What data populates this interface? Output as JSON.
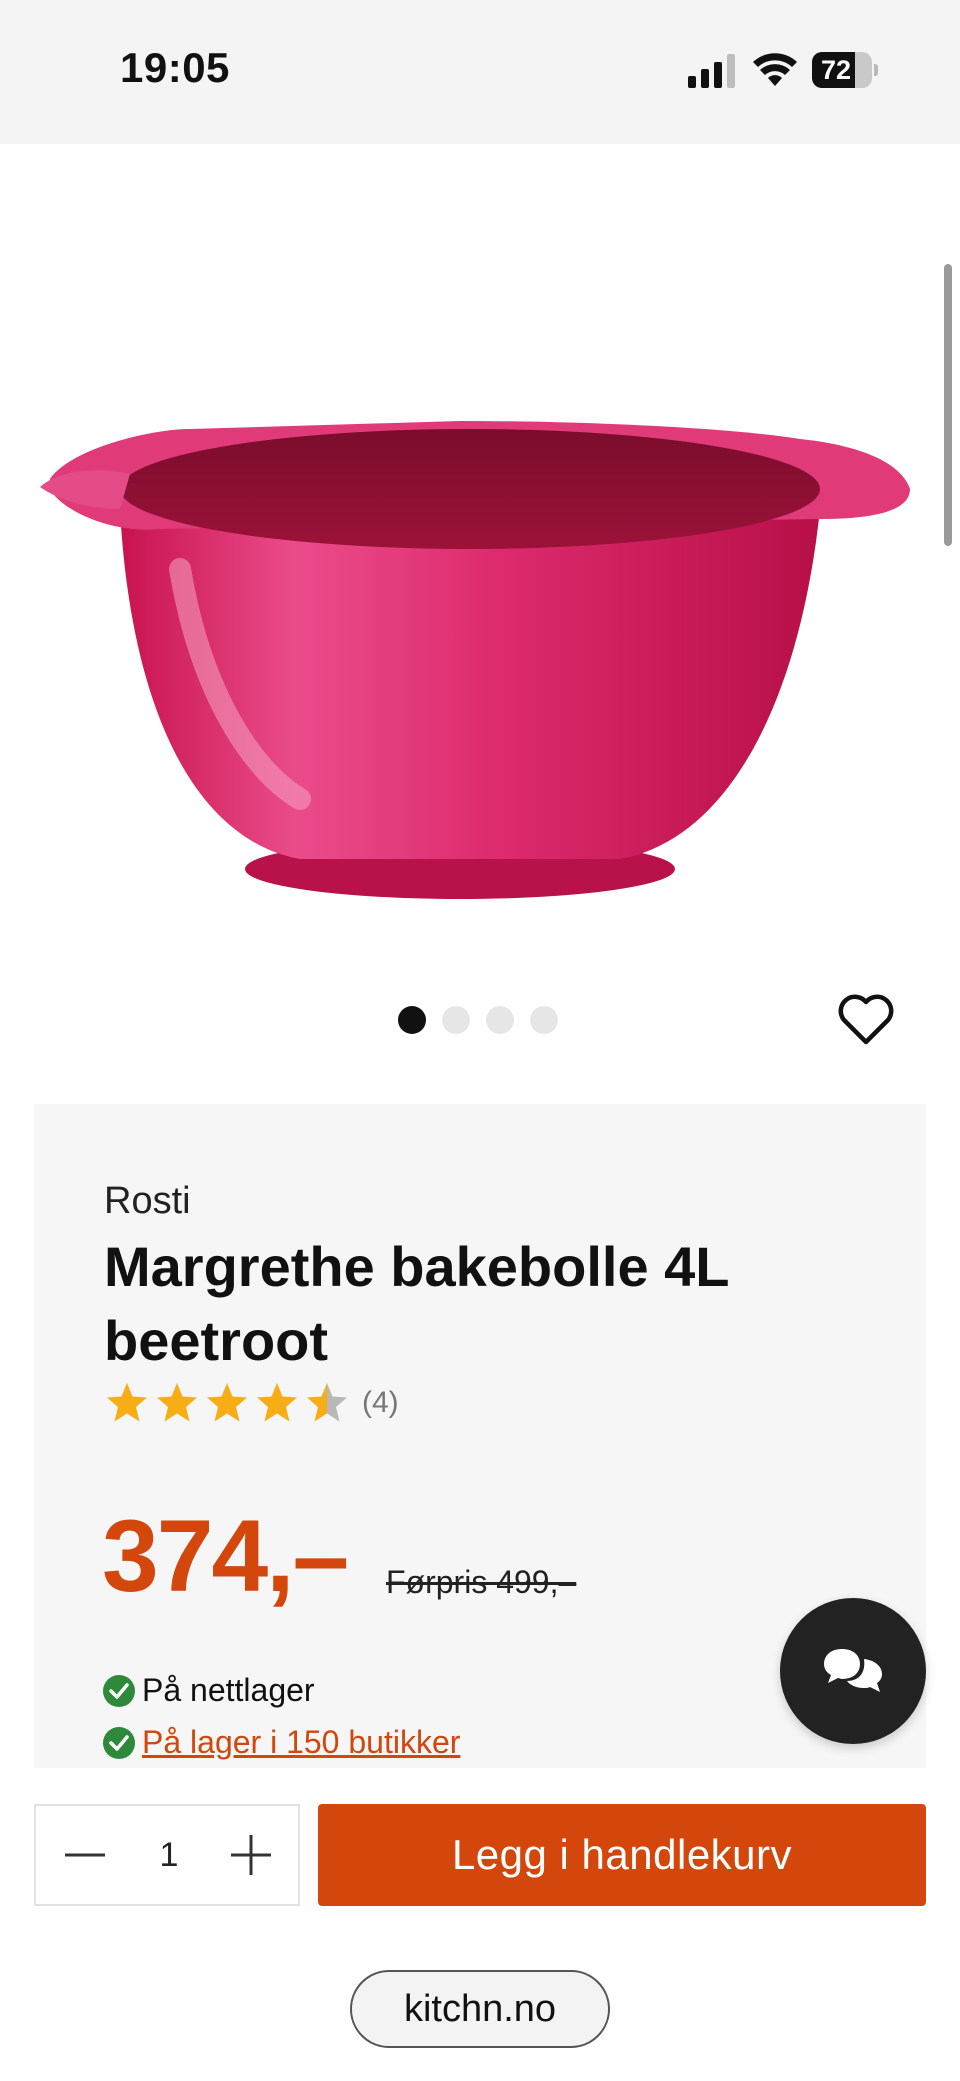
{
  "status_bar": {
    "time": "19:05",
    "battery_level": "72",
    "icons": [
      "cellular-signal-icon",
      "wifi-icon",
      "battery-icon"
    ]
  },
  "gallery": {
    "image_description": "pink mixing bowl",
    "dot_count": 4,
    "active_index": 0,
    "favorite_icon": "heart-icon"
  },
  "product": {
    "brand": "Rosti",
    "title": "Margrethe bakebolle 4L beetroot",
    "rating_value": 4.5,
    "rating_max": 5,
    "review_count": "(4)",
    "price": "374,–",
    "old_price": "Førpris 499,–",
    "stock_online": "På nettlager",
    "stock_stores": "På lager i 150 butikker"
  },
  "cart": {
    "quantity": "1",
    "add_button_label": "Legg i handlekurv"
  },
  "browser": {
    "domain": "kitchn.no"
  },
  "colors": {
    "accent": "#d4470c",
    "star": "#f6ad16",
    "check": "#2e8a3a",
    "bowl": "#d61b62"
  }
}
